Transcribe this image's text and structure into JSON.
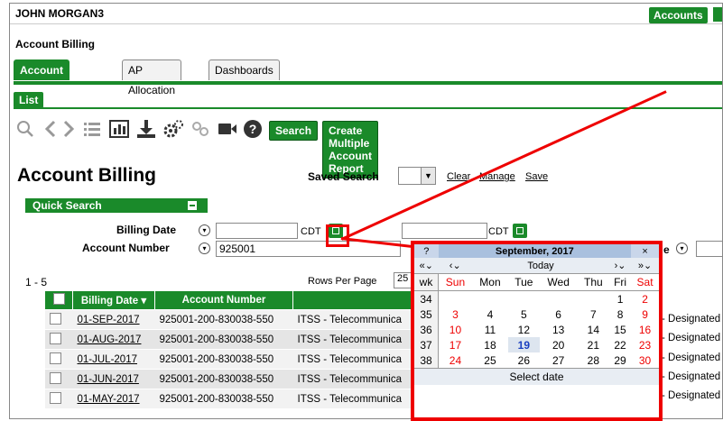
{
  "header": {
    "user": "JOHN MORGAN3",
    "accounts_button": "Accounts"
  },
  "page_heading": "Account Billing",
  "tabs": [
    {
      "label": "Account Billing",
      "active": true
    },
    {
      "label": "AP Allocation",
      "active": false
    },
    {
      "label": "Dashboards",
      "active": false
    }
  ],
  "subtab": "List",
  "toolbar": {
    "icons": [
      "search-icon",
      "back-icon",
      "forward-icon",
      "list-icon",
      "chart-icon",
      "download-icon",
      "settings-icon",
      "link-icon",
      "video-icon",
      "help-icon"
    ],
    "search_button": "Search",
    "create_report_button": "Create Multiple Account Report"
  },
  "main": {
    "title": "Account Billing",
    "saved_search_label": "Saved Search",
    "clear_link": "Clear",
    "manage_link": "Manage",
    "save_link": "Save"
  },
  "quick_search": {
    "title": "Quick Search",
    "billing_date_label": "Billing Date",
    "billing_date_from": "",
    "billing_date_to": "",
    "tz1": "CDT",
    "dash": "-",
    "tz2": "CDT",
    "account_number_label": "Account Number",
    "account_number_value": "925001",
    "partial_label_right": "e"
  },
  "results": {
    "range": "1 - 5",
    "rows_per_page_label": "Rows Per Page",
    "rows_per_page_value": "25",
    "columns": [
      "Billing Date",
      "Account Number",
      ""
    ],
    "rows": [
      {
        "billing_date": "01-SEP-2017",
        "account_number": "925001-200-830038-550",
        "desc": "ITSS - Telecommunica",
        "right": "- Designated"
      },
      {
        "billing_date": "01-AUG-2017",
        "account_number": "925001-200-830038-550",
        "desc": "ITSS - Telecommunica",
        "right": "- Designated"
      },
      {
        "billing_date": "01-JUL-2017",
        "account_number": "925001-200-830038-550",
        "desc": "ITSS - Telecommunica",
        "right": "- Designated"
      },
      {
        "billing_date": "01-JUN-2017",
        "account_number": "925001-200-830038-550",
        "desc": "ITSS - Telecommunica",
        "right": "- Designated"
      },
      {
        "billing_date": "01-MAY-2017",
        "account_number": "925001-200-830038-550",
        "desc": "ITSS - Telecommunica",
        "right": "- Designated"
      }
    ]
  },
  "calendar": {
    "help": "?",
    "month_title": "September, 2017",
    "close": "×",
    "prev_year": "«",
    "prev_month": "‹",
    "today": "Today",
    "next_month": "›",
    "next_year": "»",
    "dropdown_marker": "⌄",
    "weekday_headers": [
      "wk",
      "Sun",
      "Mon",
      "Tue",
      "Wed",
      "Thu",
      "Fri",
      "Sat"
    ],
    "weeks": [
      [
        "34",
        "",
        "",
        "",
        "",
        "",
        "1",
        "2"
      ],
      [
        "35",
        "3",
        "4",
        "5",
        "6",
        "7",
        "8",
        "9"
      ],
      [
        "36",
        "10",
        "11",
        "12",
        "13",
        "14",
        "15",
        "16"
      ],
      [
        "37",
        "17",
        "18",
        "19",
        "20",
        "21",
        "22",
        "23"
      ],
      [
        "38",
        "24",
        "25",
        "26",
        "27",
        "28",
        "29",
        "30"
      ]
    ],
    "today_day": "19",
    "footer": "Select date"
  }
}
